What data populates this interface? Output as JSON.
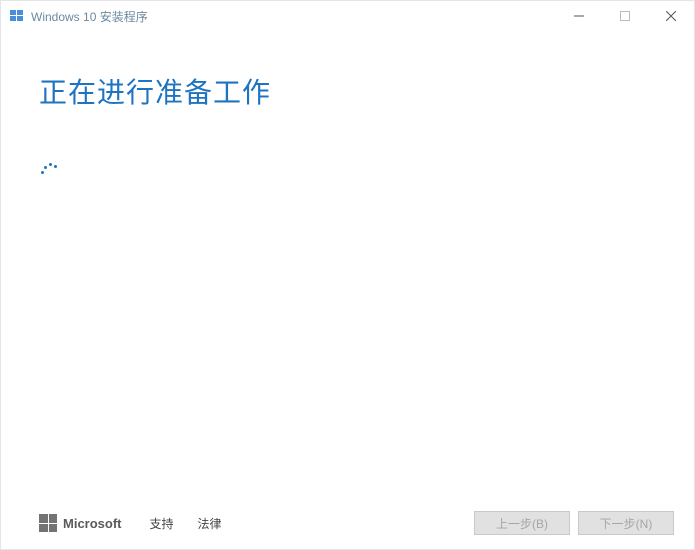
{
  "window": {
    "title": "Windows 10 安装程序"
  },
  "main": {
    "heading": "正在进行准备工作"
  },
  "footer": {
    "brand": "Microsoft",
    "support_label": "支持",
    "legal_label": "法律",
    "back_label": "上一步(B)",
    "next_label": "下一步(N)"
  }
}
